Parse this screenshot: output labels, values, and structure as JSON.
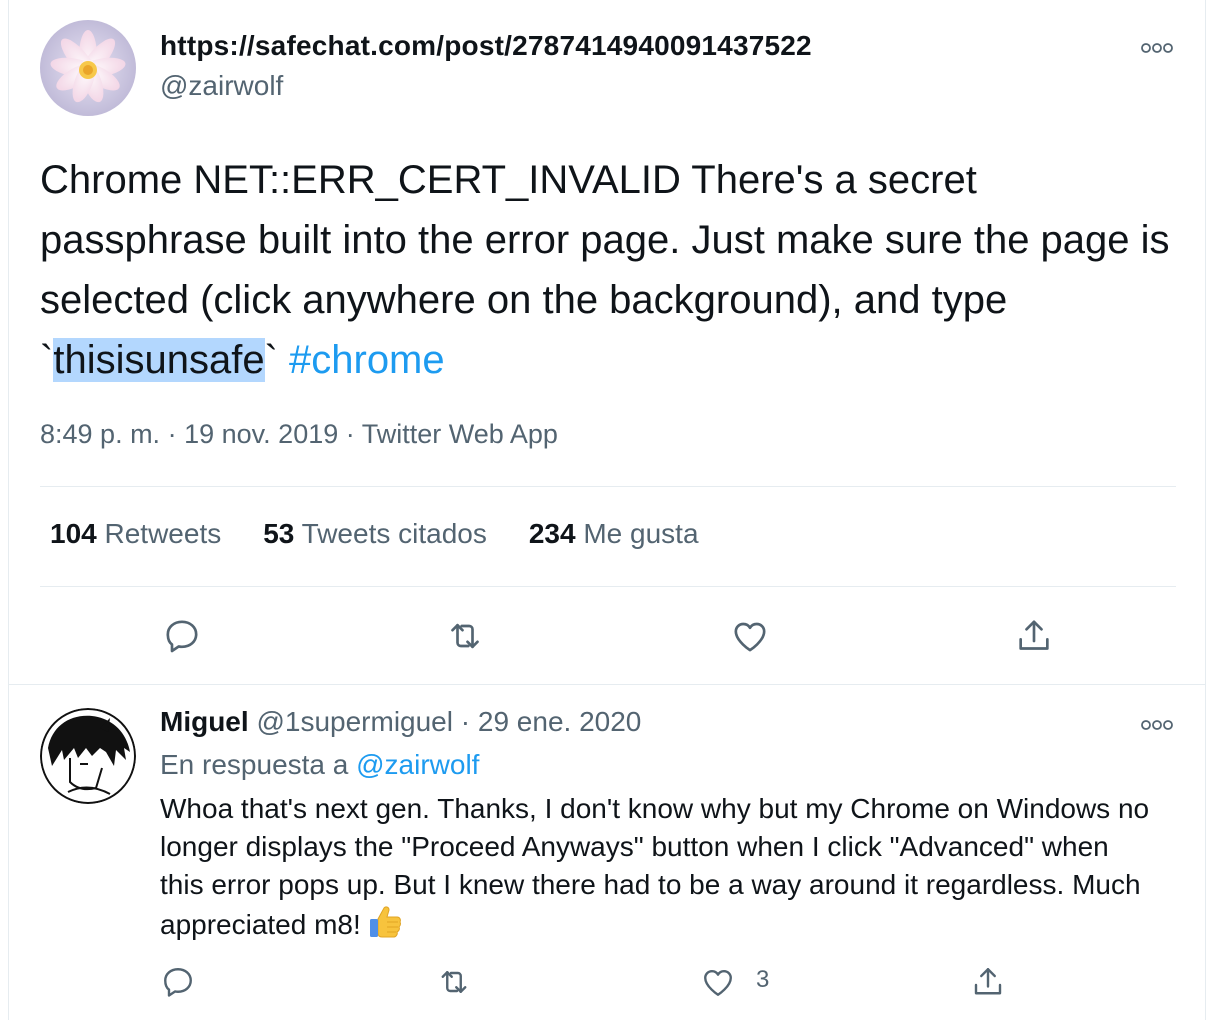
{
  "tweet": {
    "author_name": "https://safechat.com/post/2787414940091437522",
    "author_handle": "@zairwolf",
    "text_before": "Chrome NET::ERR_CERT_INVALID There's a secret passphrase built into the error page.  Just make sure the page is selected (click anywhere on the background), and type `",
    "text_selected": "thisisunsafe",
    "text_after": "` ",
    "hashtag": "#chrome",
    "time": "8:49 p. m.",
    "date": "19 nov. 2019",
    "source": "Twitter Web App",
    "separator": "·",
    "stats": {
      "retweets_count": "104",
      "retweets_label": "Retweets",
      "quotes_count": "53",
      "quotes_label": "Tweets citados",
      "likes_count": "234",
      "likes_label": "Me gusta"
    }
  },
  "reply": {
    "name": "Miguel",
    "handle": "@1supermiguel",
    "separator": "·",
    "date": "29 ene. 2020",
    "reply_to_label": "En respuesta a",
    "reply_to_handle": "@zairwolf",
    "text": "Whoa that's next gen. Thanks, I don't know why but my Chrome on Windows no longer displays the \"Proceed Anyways\" button when I click \"Advanced\" when this error pops up. But I knew there had to be a way around it regardless. Much appreciated m8!",
    "like_count": "3"
  },
  "icons": {
    "reply": "reply-icon",
    "retweet": "retweet-icon",
    "like": "heart-icon",
    "share": "share-icon",
    "more": "more-options-icon",
    "thumbs_up": "thumbs-up-emoji"
  },
  "colors": {
    "link": "#1d9bf0",
    "secondary_text": "#536471",
    "selection": "#b3d7fe",
    "divider": "#e6ecf0"
  }
}
